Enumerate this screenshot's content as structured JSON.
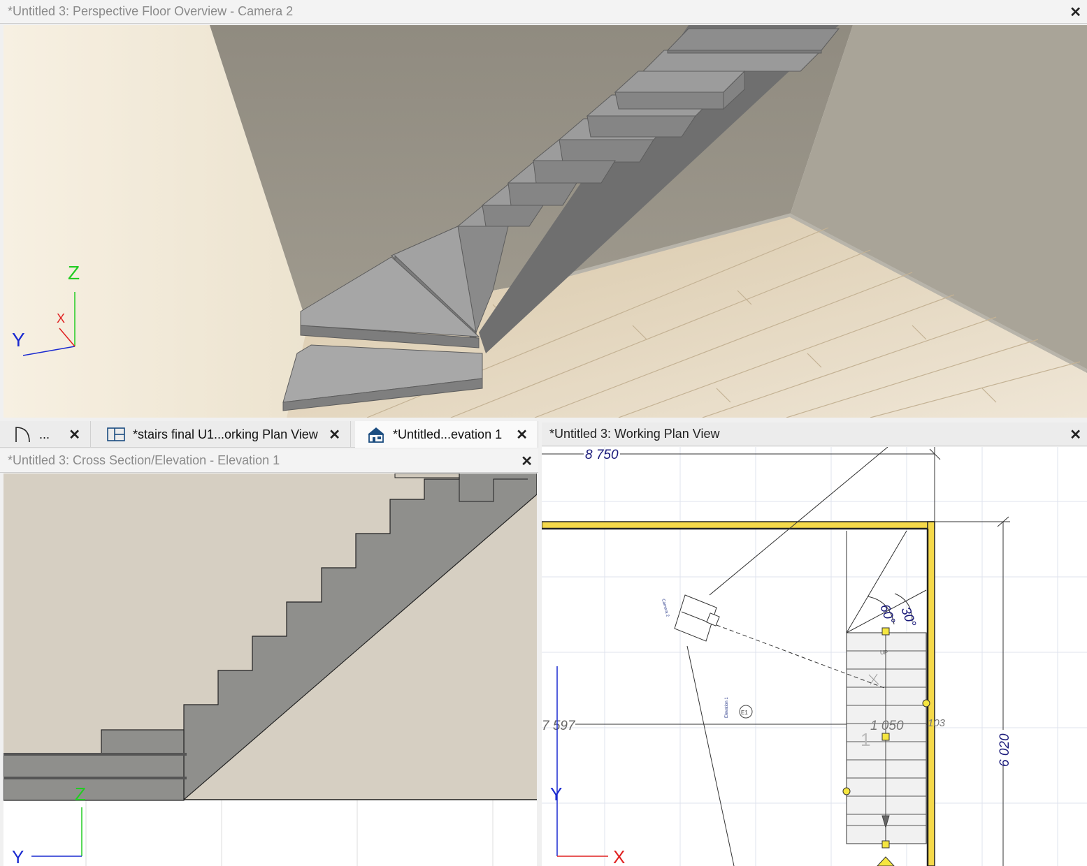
{
  "camera_window": {
    "title": "*Untitled 3: Perspective Floor Overview - Camera 2",
    "axes": {
      "z": "Z",
      "x": "X",
      "y": "Y"
    }
  },
  "tabs": [
    {
      "label": "...",
      "icon": "arc-icon"
    },
    {
      "label": "*stairs final U1...orking Plan View",
      "icon": "plan-view-icon"
    },
    {
      "label": "*Untitled...evation 1",
      "icon": "elevation-house-icon"
    }
  ],
  "elevation_window": {
    "title": "*Untitled 3: Cross Section/Elevation - Elevation 1",
    "axes": {
      "z": "Z",
      "y": "Y"
    }
  },
  "plan_window": {
    "title": "*Untitled 3:  Working Plan View",
    "dimensions": {
      "top_width": "8 750",
      "left_offset": "7 597",
      "stair_width": "1 050",
      "small": "103",
      "height": "6 020",
      "angle_a": "60°",
      "angle_b": "30°"
    },
    "labels": {
      "stair_number": "1",
      "up": "UP",
      "camera": "Camera 2",
      "elevation": "Elevation 1",
      "elev_marker": "E1"
    },
    "axes": {
      "x": "X",
      "y": "Y"
    }
  },
  "colors": {
    "wall_highlight": "#f5d94a",
    "dimension_blue": "#1a1a7a",
    "axis_red": "#e02020",
    "axis_green": "#22cc22",
    "axis_blue": "#1a2ad0"
  }
}
